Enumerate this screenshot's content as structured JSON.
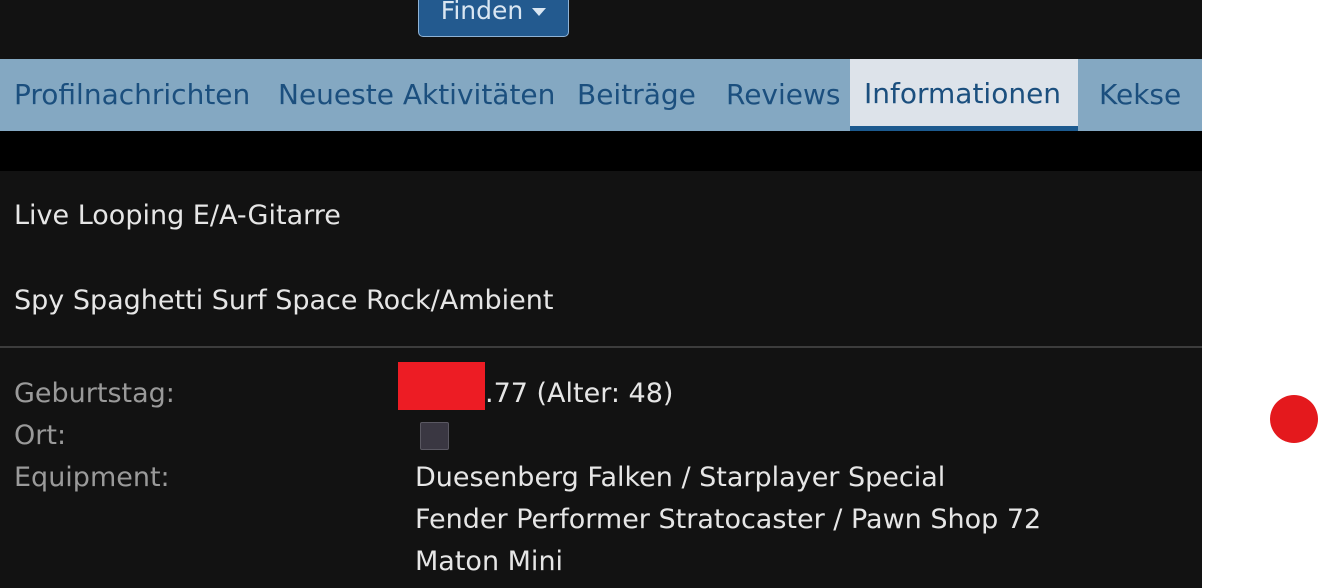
{
  "header": {
    "find_button_label": "Finden"
  },
  "tabs": [
    {
      "label": "Profilnachrichten",
      "active": false
    },
    {
      "label": "Neueste Aktivitäten",
      "active": false
    },
    {
      "label": "Beiträge",
      "active": false
    },
    {
      "label": "Reviews",
      "active": false
    },
    {
      "label": "Informationen",
      "active": true
    },
    {
      "label": "Kekse",
      "active": false
    }
  ],
  "about": {
    "line1": "Live Looping E/A-Gitarre",
    "line2": "Spy Spaghetti Surf Space Rock/Ambient"
  },
  "info": {
    "birthday_label": "Geburtstag:",
    "birthday_value": ".77 (Alter: 48)",
    "location_label": "Ort:",
    "equipment_label": "Equipment:",
    "equipment_items": [
      "Duesenberg Falken / Starplayer Special",
      "Fender Performer Stratocaster / Pawn Shop 72",
      "Maton Mini"
    ]
  },
  "colors": {
    "tab_bar": "#84a8c2",
    "tab_text": "#1b4f7e",
    "active_tab_bg": "#dde3ea",
    "active_tab_underline": "#1c5a8f",
    "button_bg": "#235a8f",
    "redaction": "#ed1c24"
  }
}
